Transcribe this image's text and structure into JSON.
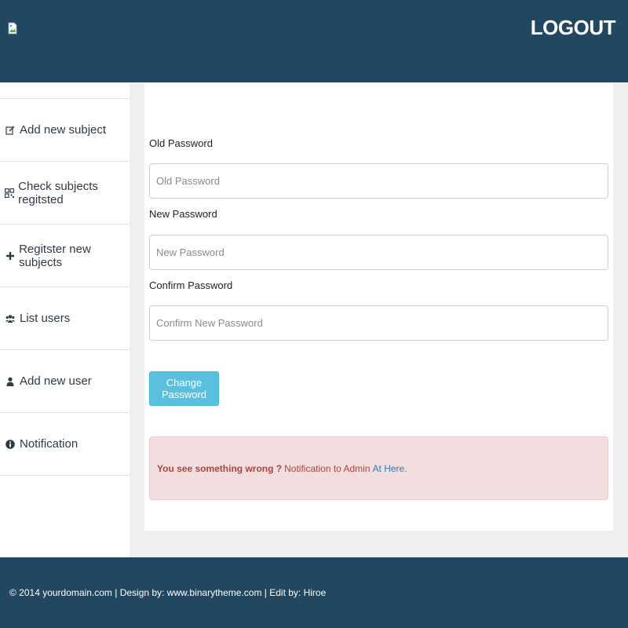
{
  "header": {
    "logout_label": "LOGOUT",
    "brand_color": "#214761"
  },
  "sidebar": {
    "items": [
      {
        "label": "Add new subject",
        "icon": "edit-icon"
      },
      {
        "label": "Check subjects regitsted",
        "icon": "qrcode-icon"
      },
      {
        "label": "Regitster new subjects",
        "icon": "plus-icon"
      },
      {
        "label": "List users",
        "icon": "users-icon"
      },
      {
        "label": "Add new user",
        "icon": "user-icon"
      },
      {
        "label": "Notification",
        "icon": "info-icon"
      }
    ]
  },
  "form": {
    "old_password_label": "Old Password",
    "old_password_placeholder": "Old Password",
    "old_password_value": "",
    "new_password_label": "New Password",
    "new_password_placeholder": "New Password",
    "new_password_value": "",
    "confirm_password_label": "Confirm Password",
    "confirm_password_placeholder": "Confirm New Password",
    "confirm_password_value": "",
    "submit_label": "Change Password",
    "button_color": "#5bc0de"
  },
  "alert": {
    "strong_text": "You see something wrong ?",
    "text": "Notification to Admin",
    "link_text": "At Here.",
    "background_color": "#f2dede"
  },
  "footer": {
    "text": "© 2014 yourdomain.com | Design by: www.binarytheme.com | Edit by: Hiroe"
  }
}
